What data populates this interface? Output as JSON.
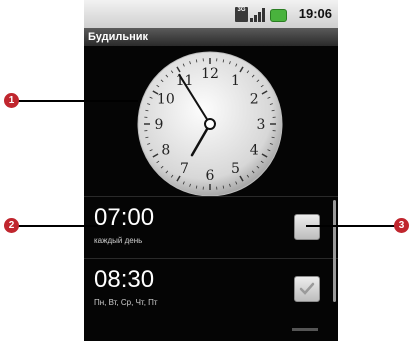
{
  "status_bar": {
    "time": "19:06",
    "network_icon": "3g-icon",
    "signal_icon": "signal-icon",
    "battery_icon": "battery-icon",
    "network_label": "3G"
  },
  "app_title": "Будильник",
  "clock": {
    "numbers": [
      "12",
      "1",
      "2",
      "3",
      "4",
      "5",
      "6",
      "7",
      "8",
      "9",
      "10",
      "11"
    ],
    "hour": 7,
    "minute": 0
  },
  "alarms": [
    {
      "time": "07:00",
      "days": "каждый день",
      "enabled": false
    },
    {
      "time": "08:30",
      "days": "Пн, Вт, Ср, Чт, Пт",
      "enabled": true
    }
  ],
  "callouts": [
    "1",
    "2",
    "3"
  ],
  "colors": {
    "callout_red": "#c0262e",
    "title_bar": "#3a3a3a",
    "battery_green": "#49b33d"
  }
}
